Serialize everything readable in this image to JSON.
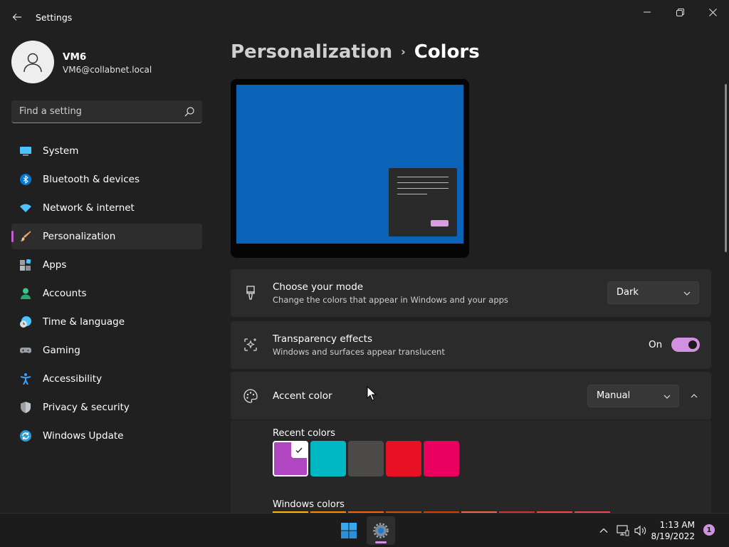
{
  "window": {
    "title": "Settings",
    "back_icon": "arrow-left-icon",
    "controls": [
      "minimize-icon",
      "restore-icon",
      "close-icon"
    ]
  },
  "user": {
    "name": "VM6",
    "email": "VM6@collabnet.local"
  },
  "search": {
    "placeholder": "Find a setting"
  },
  "sidebar": {
    "items": [
      {
        "label": "System",
        "icon": "system-icon",
        "color": "#4cc2ff"
      },
      {
        "label": "Bluetooth & devices",
        "icon": "bluetooth-icon",
        "color": "#0078d4"
      },
      {
        "label": "Network & internet",
        "icon": "wifi-icon",
        "color": "#4cc2ff"
      },
      {
        "label": "Personalization",
        "icon": "brush-icon",
        "color": "#e8a65c",
        "active": true
      },
      {
        "label": "Apps",
        "icon": "apps-icon",
        "color": "#9aa0a6"
      },
      {
        "label": "Accounts",
        "icon": "accounts-icon",
        "color": "#34c98a"
      },
      {
        "label": "Time & language",
        "icon": "clock-globe-icon",
        "color": "#4cc2ff"
      },
      {
        "label": "Gaming",
        "icon": "gamepad-icon",
        "color": "#9aa0a6"
      },
      {
        "label": "Accessibility",
        "icon": "accessibility-icon",
        "color": "#3aa0ff"
      },
      {
        "label": "Privacy & security",
        "icon": "shield-icon",
        "color": "#9aa0a6"
      },
      {
        "label": "Windows Update",
        "icon": "update-icon",
        "color": "#2c9bd6"
      }
    ]
  },
  "breadcrumb": {
    "parent": "Personalization",
    "separator": "›",
    "current": "Colors"
  },
  "settings": {
    "mode": {
      "title": "Choose your mode",
      "description": "Change the colors that appear in Windows and your apps",
      "value": "Dark",
      "icon": "paint-brush-icon"
    },
    "transparency": {
      "title": "Transparency effects",
      "description": "Windows and surfaces appear translucent",
      "state_label": "On",
      "on": true,
      "icon": "sparkle-icon"
    },
    "accent": {
      "title": "Accent color",
      "value": "Manual",
      "icon": "palette-icon",
      "expanded": true,
      "recent_heading": "Recent colors",
      "recent_colors": [
        "#b146c2",
        "#00b7c3",
        "#4c4a48",
        "#e81123",
        "#ea005e"
      ],
      "selected_index": 0,
      "windows_heading": "Windows colors",
      "windows_colors": [
        "#ffb900",
        "#ff8c00",
        "#f7630c",
        "#ca5010",
        "#da3b01",
        "#ef6950",
        "#d13438",
        "#ff4343",
        "#e74856"
      ]
    }
  },
  "accent_color": "#d291e0",
  "taskbar": {
    "apps": [
      "windows-start-icon",
      "settings-gear-icon"
    ],
    "tray": [
      "chevron-up-icon",
      "network-icon",
      "volume-icon"
    ],
    "time": "1:13 AM",
    "date": "8/19/2022",
    "notifications": "1"
  }
}
